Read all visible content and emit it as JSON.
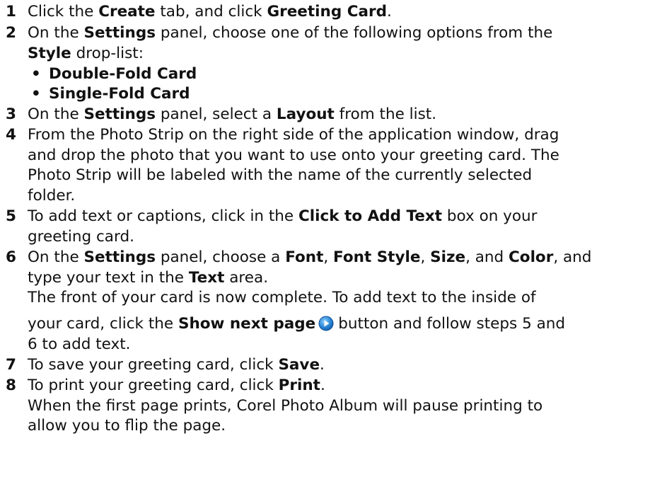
{
  "steps": {
    "s1": {
      "num": "1",
      "a": "Click the ",
      "b1": "Create",
      "c": " tab, and click ",
      "b2": "Greeting Card",
      "d": "."
    },
    "s2": {
      "num": "2",
      "a": "On the ",
      "b1": "Settings",
      "c": " panel, choose one of the following options from the",
      "b2": "Style",
      "d": " drop-list:"
    },
    "options": [
      "Double-Fold Card",
      "Single-Fold Card"
    ],
    "s3": {
      "num": "3",
      "a": "On the ",
      "b1": "Settings",
      "c": " panel, select a ",
      "b2": "Layout",
      "d": " from the list."
    },
    "s4": {
      "num": "4",
      "l1": "From the Photo Strip on the right side of the application window, drag",
      "l2": "and drop the photo that you want to use onto your greeting card. The",
      "l3": "Photo Strip will be labeled with the name of the currently selected",
      "l4": "folder."
    },
    "s5": {
      "num": "5",
      "a": "To add text or captions, click in the ",
      "b1": "Click to Add Text",
      "c": " box on your",
      "l2": "greeting card."
    },
    "s6": {
      "num": "6",
      "a": "On the ",
      "b1": "Settings",
      "c": " panel, choose a ",
      "b2": "Font",
      "s1": ", ",
      "b3": "Font Style",
      "s2": ", ",
      "b4": "Size",
      "s3": ", and ",
      "b5": "Color",
      "d": ", and",
      "l2a": "type your text in the ",
      "l2b": "Text",
      "l2c": " area.",
      "l3": "The front of your card is now complete. To add text to the inside of",
      "l4a": "your card, click the ",
      "l4b": "Show next page",
      "l4c": "button and follow steps 5 and",
      "l5": "6 to add text."
    },
    "s7": {
      "num": "7",
      "a": "To save your greeting card, click ",
      "b1": "Save",
      "d": "."
    },
    "s8": {
      "num": "8",
      "a": "To print your greeting card, click ",
      "b1": "Print",
      "d": ".",
      "l2": "When the first page prints, Corel Photo Album will pause printing to",
      "l3": "allow you to flip the page."
    }
  },
  "icons": {
    "show_next_page": "play-circle-icon",
    "accent": "#2a86d6"
  }
}
